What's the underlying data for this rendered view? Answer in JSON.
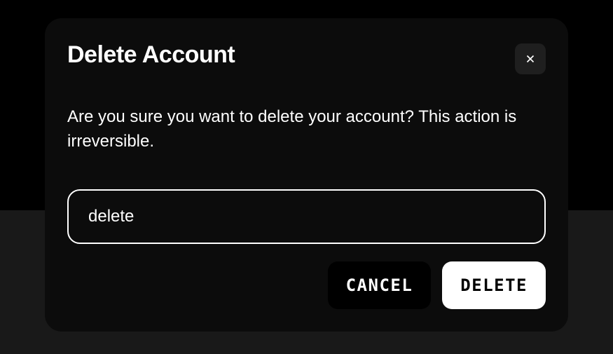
{
  "modal": {
    "title": "Delete Account",
    "message": "Are you sure you want to delete your account? This action is irreversible.",
    "input_value": "delete",
    "cancel_label": "CANCEL",
    "confirm_label": "DELETE"
  }
}
